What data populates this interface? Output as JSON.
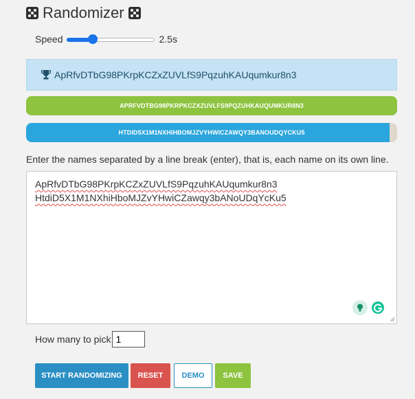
{
  "app": {
    "title": "Randomizer"
  },
  "speed": {
    "label": "Speed",
    "value_text": "2.5s",
    "level": 0.29
  },
  "result": {
    "winner": "ApRfvDTbG98PKrpKCZxZUVLfS9PqzuhKAUqumkur8n3"
  },
  "bars": [
    {
      "label": "APRFVDTBG98PKRPKCZXZUVLFS9PQZUHKAUQUMKUR8N3",
      "progress": 1.0,
      "color": "#8dc33f"
    },
    {
      "label": "HTDID5X1M1NXHIHBOMJZVYHWICZAWQY3BANOUDQYCKU5",
      "progress": 0.98,
      "color": "#2aa5dd"
    }
  ],
  "instructions": "Enter the names separated by a line break (enter), that is, each name on its own line.",
  "names_input": {
    "lines": [
      "ApRfvDTbG98PKrpKCZxZUVLfS9PqzuhKAUqumkur8n3",
      "HtdiD5X1M1NXhiHboMJZvYHwiCZawqy3bANoUDqYcKu5"
    ]
  },
  "pick": {
    "label": "How many to pick",
    "value": "1"
  },
  "buttons": {
    "start": "START RANDOMIZING",
    "reset": "RESET",
    "demo": "DEMO",
    "save": "SAVE"
  },
  "colors": {
    "accent_blue": "#2b8fc4",
    "danger": "#d9534f",
    "success": "#8dc33f",
    "winner_bg": "#c5e3f4"
  },
  "icons": [
    "dice-icon",
    "trophy-icon",
    "lightbulb-icon",
    "grammarly-icon",
    "resize-grip-icon"
  ]
}
